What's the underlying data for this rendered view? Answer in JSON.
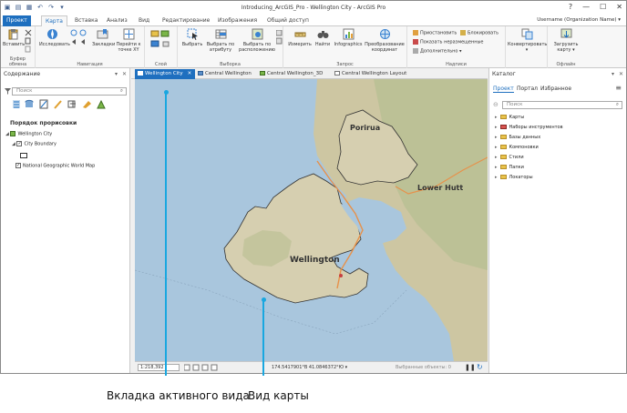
{
  "window": {
    "title": "Introducing_ArcGIS_Pro - Wellington City - ArcGIS Pro",
    "controls": [
      "?",
      "—",
      "☐",
      "✕"
    ]
  },
  "ribbon": {
    "tabs": [
      "Проект",
      "Карта",
      "Вставка",
      "Анализ",
      "Вид",
      "Редактирование",
      "Изображения",
      "Общий доступ"
    ],
    "active_tab": "Карта",
    "user": "Username (Organization Name) ▾",
    "groups": {
      "clipboard": {
        "label": "Буфер обмена",
        "paste": "Вставить"
      },
      "navigate": {
        "label": "Навигация",
        "explore": "Исследовать",
        "bookmarks": "Закладки",
        "goto_xy": "Перейти к точке XY"
      },
      "layer": {
        "label": "Слой"
      },
      "selection": {
        "label": "Выборка",
        "select": "Выбрать",
        "by_attribute": "Выбрать по атрибуту",
        "by_location": "Выбрать по расположению"
      },
      "inquiry": {
        "label": "Запрос",
        "measure": "Измерить",
        "locate": "Найти",
        "infographics": "Infographics",
        "convert_coords": "Преобразование координат"
      },
      "labeling": {
        "label": "Надписи",
        "pause": "Приостановить",
        "lock": "Блокировать",
        "unplaced": "Показать неразмещенные",
        "more": "Дополнительно ▾"
      },
      "convert": {
        "converter": "Конвертировать ▾"
      },
      "offline": {
        "label": "Офлайн",
        "download": "Загрузить карту ▾"
      }
    }
  },
  "contents": {
    "title": "Содержание",
    "search_placeholder": "Поиск",
    "drawing_order": "Порядок прорисовки",
    "map_name": "Wellington City",
    "layers": [
      "City Boundary",
      "National Geographic World Map"
    ]
  },
  "view_tabs": [
    "Wellington City",
    "Central Wellington",
    "Central Wellington_3D",
    "Central Wellington Layout"
  ],
  "map": {
    "labels": {
      "porirua": "Porirua",
      "lower_hutt": "Lower Hutt",
      "wellington": "Wellington"
    }
  },
  "statusbar": {
    "scale": "1:218,392",
    "coordinates": "174.5417901°В 41.0846372°Ю ▾",
    "selected": "Выбранные объекты: 0"
  },
  "catalog": {
    "title": "Каталог",
    "tabs": [
      "Проект",
      "Портал",
      "Избранное"
    ],
    "search_placeholder": "Поиск",
    "items": [
      "Карты",
      "Наборы инструментов",
      "Базы данных",
      "Компоновки",
      "Стили",
      "Папки",
      "Локаторы"
    ]
  },
  "captions": {
    "active_view_tab": "Вкладка активного вида",
    "map_view": "Вид карты"
  },
  "colors": {
    "accent": "#1e6fbf",
    "callout": "#19a7e0",
    "water": "#a9c6dd",
    "land": "#d8d0b4"
  }
}
